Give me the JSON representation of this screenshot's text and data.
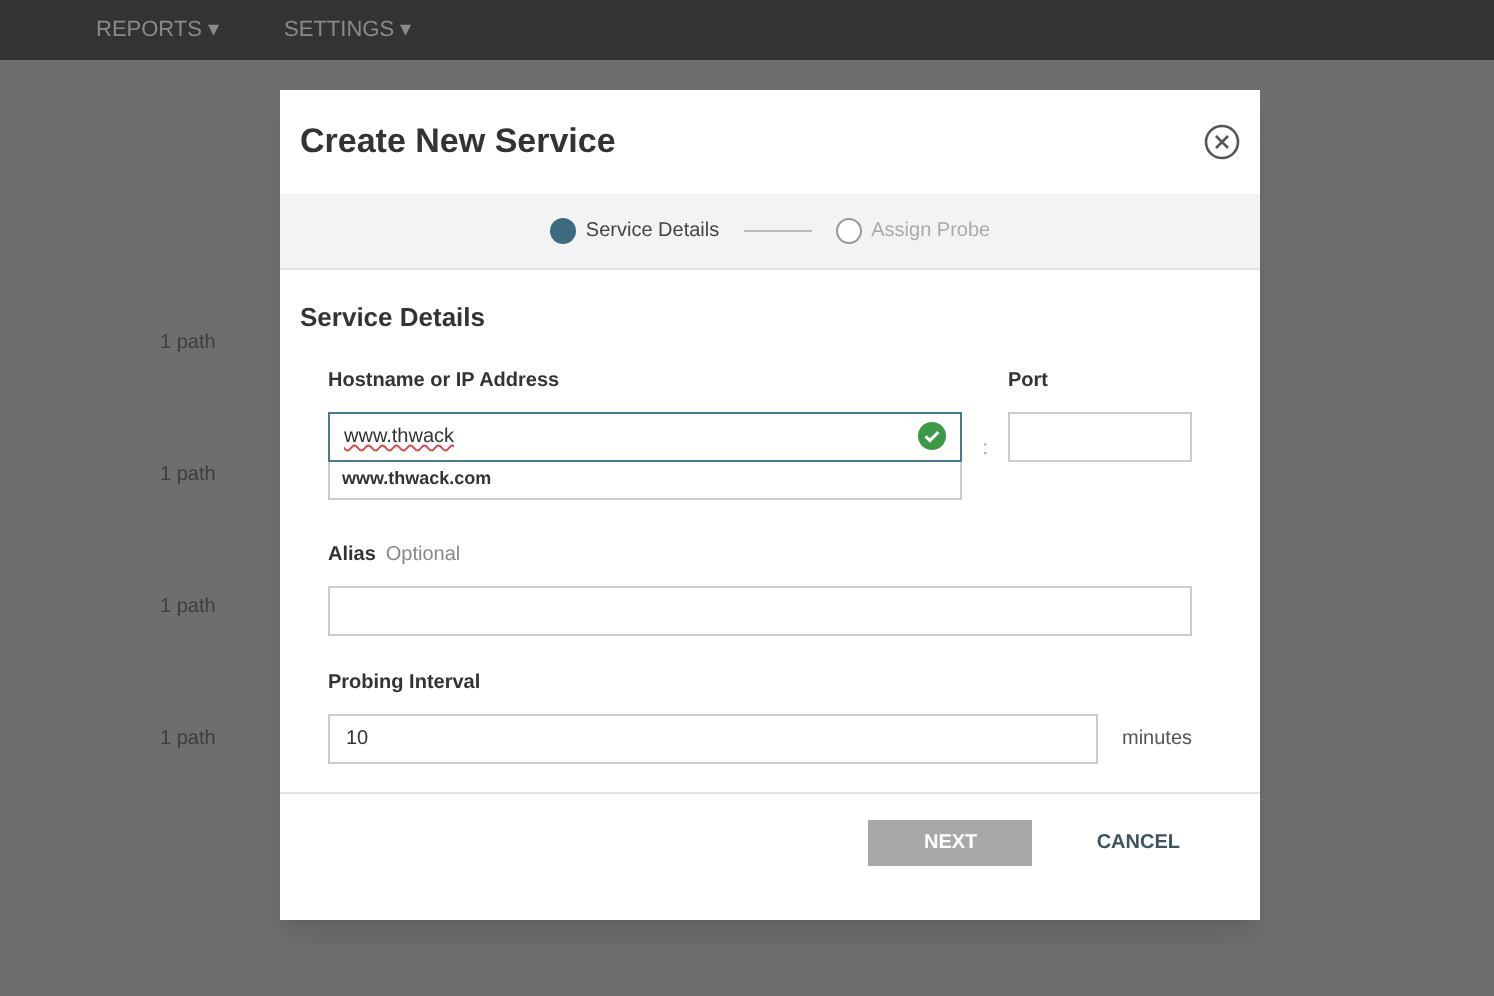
{
  "nav": [
    {
      "label": "REPORTS ▾"
    },
    {
      "label": "SETTINGS ▾"
    }
  ],
  "background_rows": [
    {
      "text": "1 path"
    },
    {
      "text": "1 path"
    },
    {
      "text": "1 path"
    },
    {
      "text": "1 path"
    }
  ],
  "dialog": {
    "title": "Create New Service",
    "steps": [
      {
        "label": "Service Details",
        "selected": true
      },
      {
        "label": "Assign Probe",
        "selected": false
      }
    ],
    "section_title": "Service Details",
    "hostname": {
      "label": "Hostname or IP Address",
      "value": "www.thwack",
      "valid": true,
      "suggestion": "www.thwack.com"
    },
    "separator": ":",
    "port": {
      "label": "Port"
    },
    "alias": {
      "label": "Alias",
      "hint": "Optional"
    },
    "interval": {
      "label": "Probing Interval",
      "value": "10",
      "unit": "minutes"
    },
    "buttons": [
      {
        "label": "NEXT",
        "kind": "primary",
        "disabled": true
      },
      {
        "label": "CANCEL",
        "kind": "link",
        "disabled": false
      }
    ]
  }
}
